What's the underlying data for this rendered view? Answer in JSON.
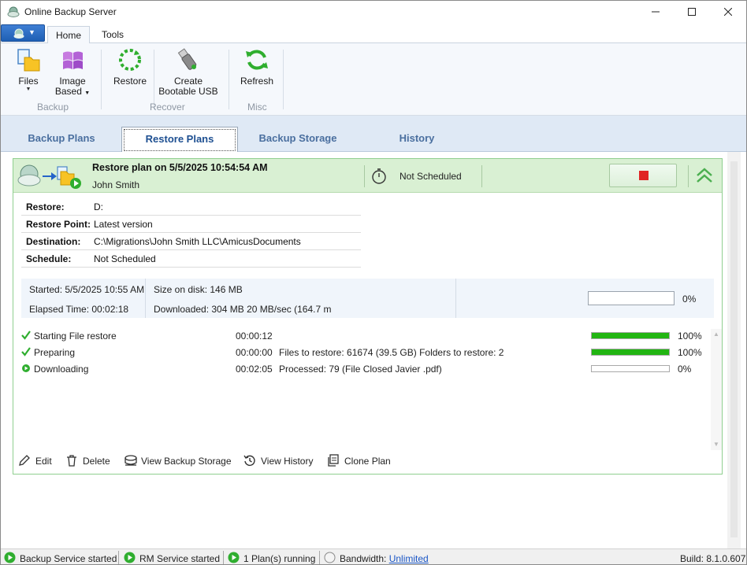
{
  "window": {
    "title": "Online Backup Server"
  },
  "ribbon": {
    "tabs": [
      {
        "label": "Home"
      },
      {
        "label": "Tools"
      }
    ],
    "groups": {
      "backup": "Backup",
      "recover": "Recover",
      "misc": "Misc"
    },
    "buttons": {
      "files": "Files",
      "image_based_1": "Image",
      "image_based_2": "Based",
      "restore": "Restore",
      "bootable_1": "Create",
      "bootable_2": "Bootable USB",
      "refresh": "Refresh"
    }
  },
  "plan_tabs": [
    "Backup Plans",
    "Restore Plans",
    "Backup Storage",
    "History"
  ],
  "plan": {
    "title": "Restore plan on 5/5/2025 10:54:54 AM",
    "user": "John Smith",
    "schedule_status": "Not Scheduled",
    "details": [
      {
        "label": "Restore:",
        "value": "D:"
      },
      {
        "label": "Restore Point:",
        "value": "Latest version"
      },
      {
        "label": "Destination:",
        "value": "C:\\Migrations\\John Smith LLC\\AmicusDocuments"
      },
      {
        "label": "Schedule:",
        "value": "Not Scheduled"
      }
    ],
    "stats": {
      "started": "Started: 5/5/2025 10:55 AM",
      "elapsed": "Elapsed Time: 00:02:18",
      "size": "Size on disk: 146 MB",
      "downloaded": "Downloaded: 304 MB 20 MB/sec (164.7 m",
      "total_percent_label": "0%",
      "total_progress": 0
    },
    "steps": [
      {
        "name": "Starting File restore",
        "time": "00:00:12",
        "info": "",
        "progress": 100,
        "percent": "100%",
        "status": "done"
      },
      {
        "name": "Preparing",
        "time": "00:00:00",
        "info": "Files to restore: 61674 (39.5 GB)  Folders to restore: 2",
        "progress": 100,
        "percent": "100%",
        "status": "done"
      },
      {
        "name": "Downloading",
        "time": "00:02:05",
        "info": "Processed: 79 (File Closed Javier .pdf)",
        "progress": 0,
        "percent": "0%",
        "status": "running"
      }
    ],
    "actions": [
      "Edit",
      "Delete",
      "View Backup Storage",
      "View History",
      "Clone Plan"
    ]
  },
  "statusbar": {
    "backup_service": "Backup Service started",
    "rm_service": "RM Service started",
    "plans_running": "1 Plan(s) running",
    "bandwidth_label": "Bandwidth:",
    "bandwidth_value": "Unlimited",
    "build": "Build: 8.1.0.607"
  },
  "colors": {
    "accent": "#1d4f91",
    "success": "#22b512",
    "stop": "#e02424",
    "plan_header": "#d9f0d3"
  }
}
